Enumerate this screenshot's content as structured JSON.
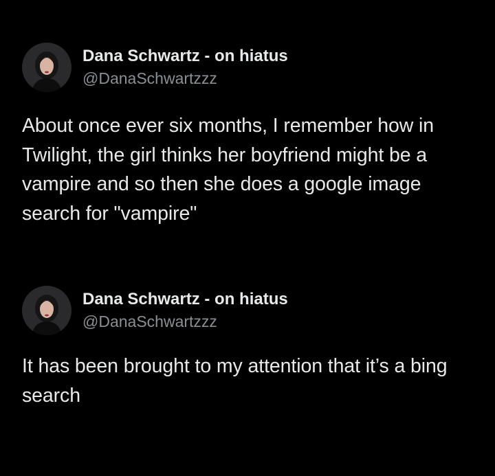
{
  "theme": {
    "background": "#000000",
    "text": "#e7e9ea",
    "secondary_text": "#8b8f94"
  },
  "tweets": [
    {
      "display_name": "Dana Schwartz - on hiatus",
      "handle": "@DanaSchwartzzz",
      "avatar_icon": "profile-photo",
      "text": "About once ever six months, I remember how in Twilight, the girl thinks her boyfriend might be a vampire and so then she does a google image search for \"vampire\""
    },
    {
      "display_name": "Dana Schwartz - on hiatus",
      "handle": "@DanaSchwartzzz",
      "avatar_icon": "profile-photo",
      "text": "It has been brought to my attention that it’s a bing search"
    }
  ]
}
